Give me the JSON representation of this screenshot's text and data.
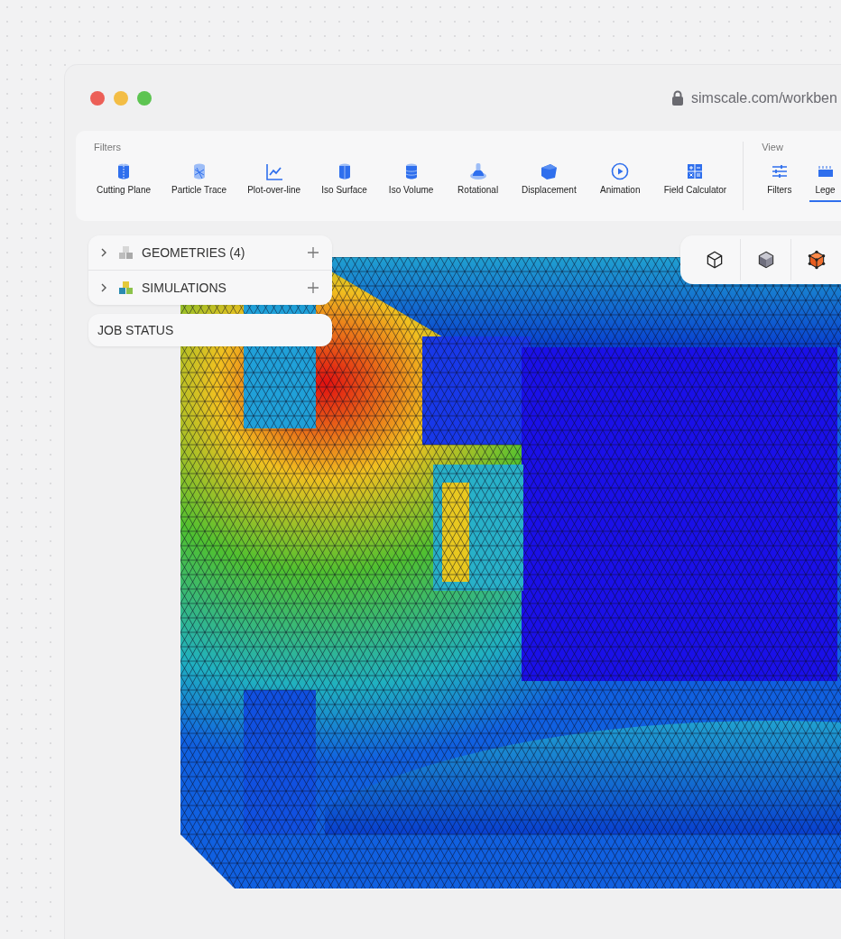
{
  "window": {
    "url": "simscale.com/workben"
  },
  "toolbar": {
    "filters_label": "Filters",
    "view_label": "View",
    "filters": [
      {
        "label": "Cutting Plane",
        "kind": "cutting"
      },
      {
        "label": "Particle Trace",
        "kind": "particle"
      },
      {
        "label": "Plot-over-line",
        "kind": "plot"
      },
      {
        "label": "Iso Surface",
        "kind": "isosurface"
      },
      {
        "label": "Iso Volume",
        "kind": "isovolume"
      },
      {
        "label": "Rotational",
        "kind": "rotational"
      },
      {
        "label": "Displacement",
        "kind": "displacement"
      },
      {
        "label": "Animation",
        "kind": "animation"
      },
      {
        "label": "Field Calculator",
        "kind": "calculator"
      }
    ],
    "view_tabs": [
      {
        "label": "Filters",
        "kind": "sliders",
        "selected": false
      },
      {
        "label": "Lege",
        "kind": "legend",
        "selected": true
      }
    ]
  },
  "tree": [
    {
      "label": "GEOMETRIES (4)",
      "kind": "geometries",
      "expanded": false
    },
    {
      "label": "SIMULATIONS",
      "kind": "simulations",
      "expanded": false
    }
  ],
  "job_status": {
    "label": "JOB STATUS"
  },
  "view_modes": [
    {
      "kind": "wireframe"
    },
    {
      "kind": "solid"
    },
    {
      "kind": "mesh"
    }
  ]
}
